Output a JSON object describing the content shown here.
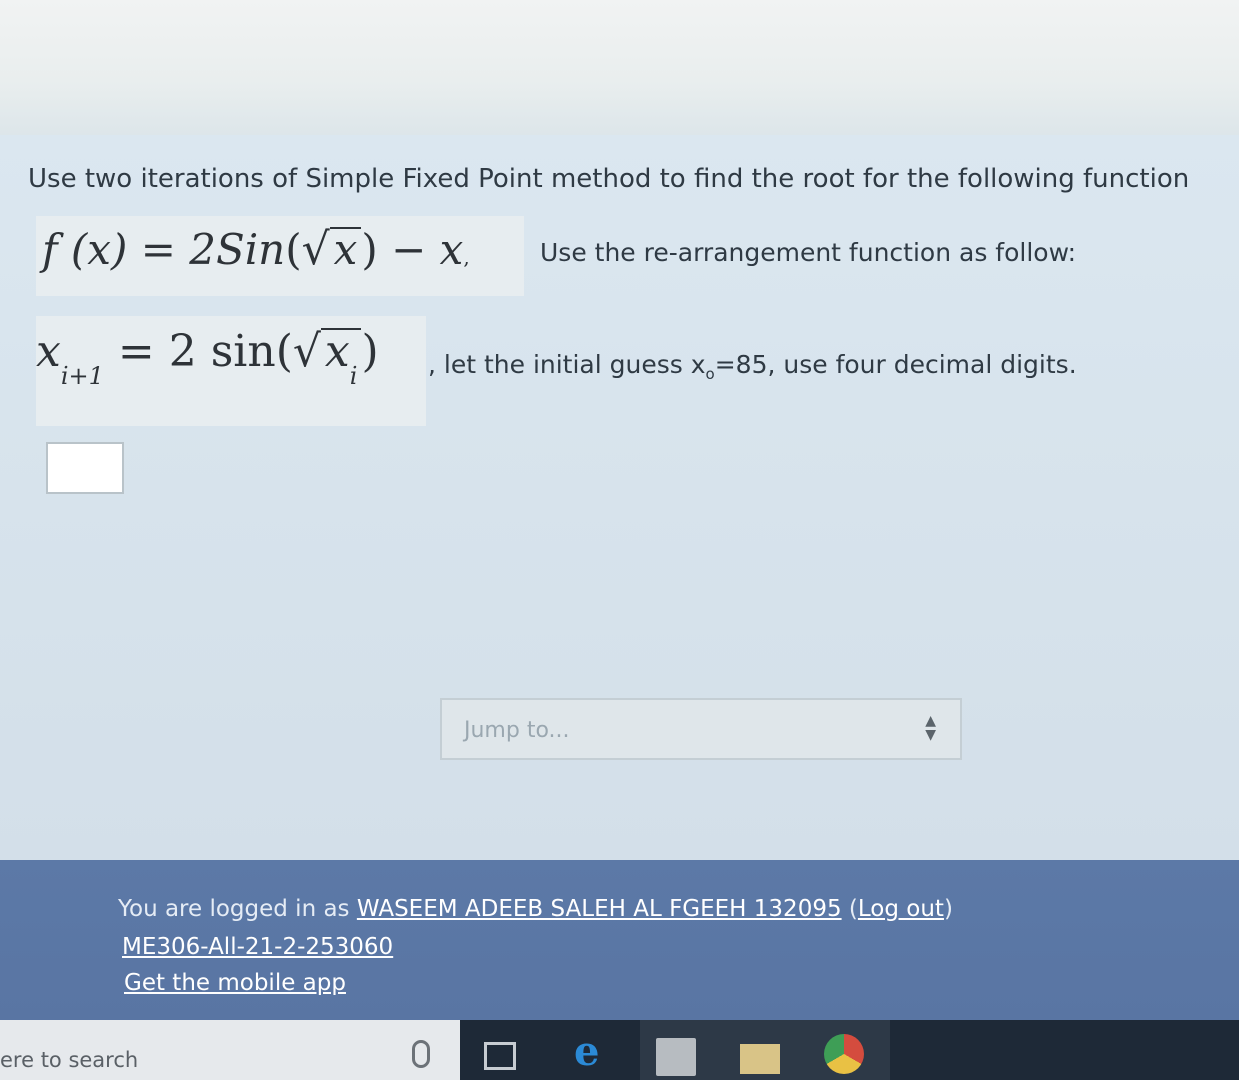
{
  "question": {
    "intro": "Use two iterations of Simple Fixed Point method to find the root for the following function",
    "function_parts": {
      "lhs": "f (x) = 2",
      "sin_word": "Sin",
      "open": "(",
      "var": "x",
      "close": ") − ",
      "tail_var": "x",
      "comma": ","
    },
    "rearrangement_text": "Use the re-arrangement function as follow:",
    "iteration_parts": {
      "var": "x",
      "sub": "i+1",
      "eq": " = 2 sin(",
      "inner_var": "x",
      "inner_sub": "i",
      "close": ")"
    },
    "guess_text_before": ", let the initial guess x",
    "guess_sub": "o",
    "guess_text_after": "=85, use four decimal digits."
  },
  "answer": {
    "value": ""
  },
  "jump": {
    "placeholder": "Jump to...",
    "arrow_up": "▲",
    "arrow_down": "▼"
  },
  "footer": {
    "logged_in_prefix": "You are logged in as ",
    "user_name": "WASEEM ADEEB SALEH AL FGEEH 132095",
    "logout_open": " (",
    "logout": "Log out",
    "logout_close": ")",
    "course": "ME306-All-21-2-253060",
    "mobile_app": "Get the mobile app"
  },
  "taskbar": {
    "search_placeholder": "ere to search",
    "edge_glyph": "e"
  },
  "colors": {
    "panel": "#d7e3ec",
    "footer": "#5975a3",
    "taskbar": "#1e2937"
  }
}
